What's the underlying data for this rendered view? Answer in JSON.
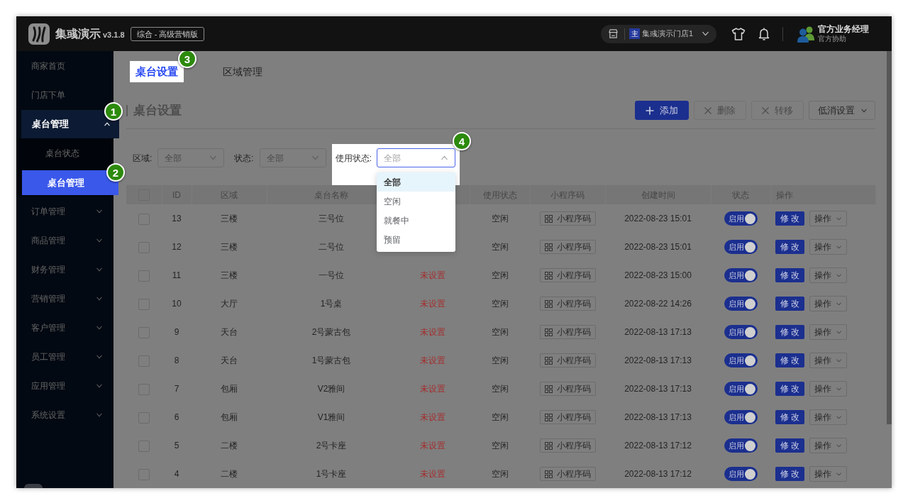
{
  "app": {
    "name": "集彧演示",
    "version": "v3.1.8",
    "edition": "综合 - 高级营销版"
  },
  "store": {
    "tag": "主",
    "name": "集彧演示门店1"
  },
  "user": {
    "name": "官方业务经理",
    "role": "官方协助"
  },
  "sidebar": {
    "items": [
      {
        "label": "商家首页",
        "kind": "link",
        "selected": false
      },
      {
        "label": "门店下单",
        "kind": "link",
        "selected": false
      },
      {
        "label": "桌台管理",
        "kind": "group",
        "selected": true,
        "expanded": true,
        "callout": "1",
        "children": [
          {
            "label": "桌台状态",
            "selected": false
          },
          {
            "label": "桌台管理",
            "selected": true,
            "callout": "2"
          }
        ]
      },
      {
        "label": "订单管理",
        "kind": "group",
        "selected": false,
        "expanded": false
      },
      {
        "label": "商品管理",
        "kind": "group",
        "selected": false,
        "expanded": false
      },
      {
        "label": "财务管理",
        "kind": "group",
        "selected": false,
        "expanded": false
      },
      {
        "label": "营销管理",
        "kind": "group",
        "selected": false,
        "expanded": false
      },
      {
        "label": "客户管理",
        "kind": "group",
        "selected": false,
        "expanded": false
      },
      {
        "label": "员工管理",
        "kind": "group",
        "selected": false,
        "expanded": false
      },
      {
        "label": "应用管理",
        "kind": "group",
        "selected": false,
        "expanded": false
      },
      {
        "label": "系统设置",
        "kind": "group",
        "selected": false,
        "expanded": false
      }
    ]
  },
  "tabs": [
    {
      "label": "桌台设置",
      "selected": true,
      "callout": "3"
    },
    {
      "label": "区域管理",
      "selected": false
    }
  ],
  "page_title": "桌台设置",
  "toolbar": [
    {
      "label": "添加",
      "kind": "primary",
      "disabled": false
    },
    {
      "label": "删除",
      "kind": "plain",
      "disabled": true
    },
    {
      "label": "转移",
      "kind": "plain",
      "disabled": true
    },
    {
      "label": "低消设置",
      "kind": "menu",
      "disabled": false
    }
  ],
  "filters": [
    {
      "label": "区域:",
      "value": "全部",
      "open": false
    },
    {
      "label": "状态:",
      "value": "全部",
      "open": false
    },
    {
      "label": "使用状态:",
      "value": "全部",
      "open": true,
      "callout": "4",
      "options": [
        {
          "label": "全部",
          "selected": true
        },
        {
          "label": "空闲",
          "selected": false
        },
        {
          "label": "就餐中",
          "selected": false
        },
        {
          "label": "预留",
          "selected": false
        }
      ]
    }
  ],
  "table": {
    "select_all_checked": false,
    "header": {
      "id": "ID",
      "area": "区域",
      "name": "桌台名称",
      "usage": "使用状态",
      "qrcode": "小程序码",
      "created": "创建时间",
      "status": "状态",
      "actions": "操作"
    },
    "rows": [
      {
        "checked": false,
        "id": "13",
        "area": "三楼",
        "name": "三号位",
        "usage": "空闲",
        "qrcode": "小程序码",
        "created": "2022-08-23 15:01",
        "enabled": true,
        "status": "启用",
        "edit": "修 改",
        "more": "操作"
      },
      {
        "checked": false,
        "id": "12",
        "area": "三楼",
        "name": "二号位",
        "usage": "空闲",
        "qrcode": "小程序码",
        "created": "2022-08-23 15:01",
        "enabled": true,
        "status": "启用",
        "edit": "修 改",
        "more": "操作"
      },
      {
        "checked": false,
        "id": "11",
        "area": "三楼",
        "name": "一号位",
        "column_4": "未设置",
        "usage": "空闲",
        "qrcode": "小程序码",
        "created": "2022-08-23 15:00",
        "enabled": true,
        "status": "启用",
        "edit": "修 改",
        "more": "操作"
      },
      {
        "checked": false,
        "id": "10",
        "area": "大厅",
        "name": "1号桌",
        "column_4": "未设置",
        "usage": "空闲",
        "qrcode": "小程序码",
        "created": "2022-08-22 14:26",
        "enabled": true,
        "status": "启用",
        "edit": "修 改",
        "more": "操作"
      },
      {
        "checked": false,
        "id": "9",
        "area": "天台",
        "name": "2号蒙古包",
        "column_4": "未设置",
        "usage": "空闲",
        "qrcode": "小程序码",
        "created": "2022-08-13 17:13",
        "enabled": true,
        "status": "启用",
        "edit": "修 改",
        "more": "操作"
      },
      {
        "checked": false,
        "id": "8",
        "area": "天台",
        "name": "1号蒙古包",
        "column_4": "未设置",
        "usage": "空闲",
        "qrcode": "小程序码",
        "created": "2022-08-13 17:13",
        "enabled": true,
        "status": "启用",
        "edit": "修 改",
        "more": "操作"
      },
      {
        "checked": false,
        "id": "7",
        "area": "包厢",
        "name": "V2雅间",
        "column_4": "未设置",
        "usage": "空闲",
        "qrcode": "小程序码",
        "created": "2022-08-13 17:13",
        "enabled": true,
        "status": "启用",
        "edit": "修 改",
        "more": "操作"
      },
      {
        "checked": false,
        "id": "6",
        "area": "包厢",
        "name": "V1雅间",
        "column_4": "未设置",
        "usage": "空闲",
        "qrcode": "小程序码",
        "created": "2022-08-13 17:13",
        "enabled": true,
        "status": "启用",
        "edit": "修 改",
        "more": "操作"
      },
      {
        "checked": false,
        "id": "5",
        "area": "二楼",
        "name": "2号卡座",
        "column_4": "未设置",
        "usage": "空闲",
        "qrcode": "小程序码",
        "created": "2022-08-13 17:12",
        "enabled": true,
        "status": "启用",
        "edit": "修 改",
        "more": "操作"
      },
      {
        "checked": false,
        "id": "4",
        "area": "二楼",
        "name": "1号卡座",
        "column_4": "未设置",
        "usage": "空闲",
        "qrcode": "小程序码",
        "created": "2022-08-13 17:12",
        "enabled": true,
        "status": "启用",
        "edit": "修 改",
        "more": "操作"
      }
    ]
  }
}
